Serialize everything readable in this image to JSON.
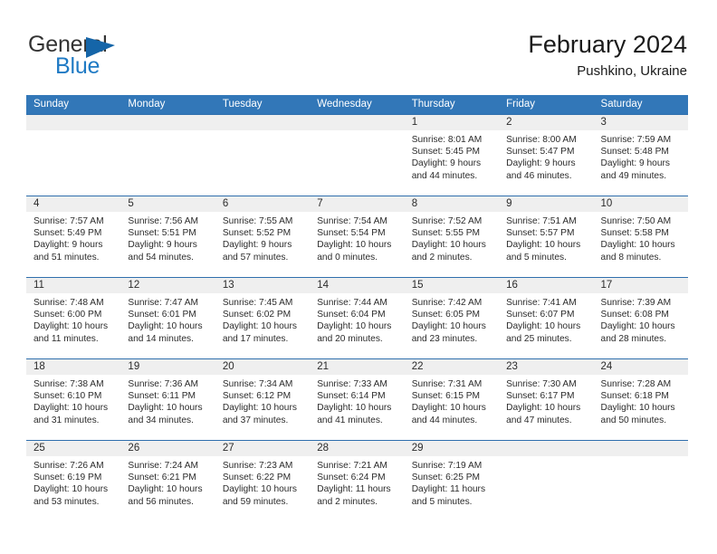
{
  "brand": {
    "name_top": "General",
    "name_bottom": "Blue",
    "triangle_color": "#1565a8",
    "blue_color": "#1f7ac4"
  },
  "header": {
    "title": "February 2024",
    "subtitle": "Pushkino, Ukraine"
  },
  "theme": {
    "header_blue": "#3277b8",
    "row_border_blue": "#2f6fad",
    "daynum_band": "#efefef",
    "text": "#2b2b2b"
  },
  "weekdays": [
    "Sunday",
    "Monday",
    "Tuesday",
    "Wednesday",
    "Thursday",
    "Friday",
    "Saturday"
  ],
  "weeks": [
    [
      {
        "day": "",
        "sunrise": "",
        "sunset": "",
        "daylight_1": "",
        "daylight_2": ""
      },
      {
        "day": "",
        "sunrise": "",
        "sunset": "",
        "daylight_1": "",
        "daylight_2": ""
      },
      {
        "day": "",
        "sunrise": "",
        "sunset": "",
        "daylight_1": "",
        "daylight_2": ""
      },
      {
        "day": "",
        "sunrise": "",
        "sunset": "",
        "daylight_1": "",
        "daylight_2": ""
      },
      {
        "day": "1",
        "sunrise": "Sunrise: 8:01 AM",
        "sunset": "Sunset: 5:45 PM",
        "daylight_1": "Daylight: 9 hours",
        "daylight_2": "and 44 minutes."
      },
      {
        "day": "2",
        "sunrise": "Sunrise: 8:00 AM",
        "sunset": "Sunset: 5:47 PM",
        "daylight_1": "Daylight: 9 hours",
        "daylight_2": "and 46 minutes."
      },
      {
        "day": "3",
        "sunrise": "Sunrise: 7:59 AM",
        "sunset": "Sunset: 5:48 PM",
        "daylight_1": "Daylight: 9 hours",
        "daylight_2": "and 49 minutes."
      }
    ],
    [
      {
        "day": "4",
        "sunrise": "Sunrise: 7:57 AM",
        "sunset": "Sunset: 5:49 PM",
        "daylight_1": "Daylight: 9 hours",
        "daylight_2": "and 51 minutes."
      },
      {
        "day": "5",
        "sunrise": "Sunrise: 7:56 AM",
        "sunset": "Sunset: 5:51 PM",
        "daylight_1": "Daylight: 9 hours",
        "daylight_2": "and 54 minutes."
      },
      {
        "day": "6",
        "sunrise": "Sunrise: 7:55 AM",
        "sunset": "Sunset: 5:52 PM",
        "daylight_1": "Daylight: 9 hours",
        "daylight_2": "and 57 minutes."
      },
      {
        "day": "7",
        "sunrise": "Sunrise: 7:54 AM",
        "sunset": "Sunset: 5:54 PM",
        "daylight_1": "Daylight: 10 hours",
        "daylight_2": "and 0 minutes."
      },
      {
        "day": "8",
        "sunrise": "Sunrise: 7:52 AM",
        "sunset": "Sunset: 5:55 PM",
        "daylight_1": "Daylight: 10 hours",
        "daylight_2": "and 2 minutes."
      },
      {
        "day": "9",
        "sunrise": "Sunrise: 7:51 AM",
        "sunset": "Sunset: 5:57 PM",
        "daylight_1": "Daylight: 10 hours",
        "daylight_2": "and 5 minutes."
      },
      {
        "day": "10",
        "sunrise": "Sunrise: 7:50 AM",
        "sunset": "Sunset: 5:58 PM",
        "daylight_1": "Daylight: 10 hours",
        "daylight_2": "and 8 minutes."
      }
    ],
    [
      {
        "day": "11",
        "sunrise": "Sunrise: 7:48 AM",
        "sunset": "Sunset: 6:00 PM",
        "daylight_1": "Daylight: 10 hours",
        "daylight_2": "and 11 minutes."
      },
      {
        "day": "12",
        "sunrise": "Sunrise: 7:47 AM",
        "sunset": "Sunset: 6:01 PM",
        "daylight_1": "Daylight: 10 hours",
        "daylight_2": "and 14 minutes."
      },
      {
        "day": "13",
        "sunrise": "Sunrise: 7:45 AM",
        "sunset": "Sunset: 6:02 PM",
        "daylight_1": "Daylight: 10 hours",
        "daylight_2": "and 17 minutes."
      },
      {
        "day": "14",
        "sunrise": "Sunrise: 7:44 AM",
        "sunset": "Sunset: 6:04 PM",
        "daylight_1": "Daylight: 10 hours",
        "daylight_2": "and 20 minutes."
      },
      {
        "day": "15",
        "sunrise": "Sunrise: 7:42 AM",
        "sunset": "Sunset: 6:05 PM",
        "daylight_1": "Daylight: 10 hours",
        "daylight_2": "and 23 minutes."
      },
      {
        "day": "16",
        "sunrise": "Sunrise: 7:41 AM",
        "sunset": "Sunset: 6:07 PM",
        "daylight_1": "Daylight: 10 hours",
        "daylight_2": "and 25 minutes."
      },
      {
        "day": "17",
        "sunrise": "Sunrise: 7:39 AM",
        "sunset": "Sunset: 6:08 PM",
        "daylight_1": "Daylight: 10 hours",
        "daylight_2": "and 28 minutes."
      }
    ],
    [
      {
        "day": "18",
        "sunrise": "Sunrise: 7:38 AM",
        "sunset": "Sunset: 6:10 PM",
        "daylight_1": "Daylight: 10 hours",
        "daylight_2": "and 31 minutes."
      },
      {
        "day": "19",
        "sunrise": "Sunrise: 7:36 AM",
        "sunset": "Sunset: 6:11 PM",
        "daylight_1": "Daylight: 10 hours",
        "daylight_2": "and 34 minutes."
      },
      {
        "day": "20",
        "sunrise": "Sunrise: 7:34 AM",
        "sunset": "Sunset: 6:12 PM",
        "daylight_1": "Daylight: 10 hours",
        "daylight_2": "and 37 minutes."
      },
      {
        "day": "21",
        "sunrise": "Sunrise: 7:33 AM",
        "sunset": "Sunset: 6:14 PM",
        "daylight_1": "Daylight: 10 hours",
        "daylight_2": "and 41 minutes."
      },
      {
        "day": "22",
        "sunrise": "Sunrise: 7:31 AM",
        "sunset": "Sunset: 6:15 PM",
        "daylight_1": "Daylight: 10 hours",
        "daylight_2": "and 44 minutes."
      },
      {
        "day": "23",
        "sunrise": "Sunrise: 7:30 AM",
        "sunset": "Sunset: 6:17 PM",
        "daylight_1": "Daylight: 10 hours",
        "daylight_2": "and 47 minutes."
      },
      {
        "day": "24",
        "sunrise": "Sunrise: 7:28 AM",
        "sunset": "Sunset: 6:18 PM",
        "daylight_1": "Daylight: 10 hours",
        "daylight_2": "and 50 minutes."
      }
    ],
    [
      {
        "day": "25",
        "sunrise": "Sunrise: 7:26 AM",
        "sunset": "Sunset: 6:19 PM",
        "daylight_1": "Daylight: 10 hours",
        "daylight_2": "and 53 minutes."
      },
      {
        "day": "26",
        "sunrise": "Sunrise: 7:24 AM",
        "sunset": "Sunset: 6:21 PM",
        "daylight_1": "Daylight: 10 hours",
        "daylight_2": "and 56 minutes."
      },
      {
        "day": "27",
        "sunrise": "Sunrise: 7:23 AM",
        "sunset": "Sunset: 6:22 PM",
        "daylight_1": "Daylight: 10 hours",
        "daylight_2": "and 59 minutes."
      },
      {
        "day": "28",
        "sunrise": "Sunrise: 7:21 AM",
        "sunset": "Sunset: 6:24 PM",
        "daylight_1": "Daylight: 11 hours",
        "daylight_2": "and 2 minutes."
      },
      {
        "day": "29",
        "sunrise": "Sunrise: 7:19 AM",
        "sunset": "Sunset: 6:25 PM",
        "daylight_1": "Daylight: 11 hours",
        "daylight_2": "and 5 minutes."
      },
      {
        "day": "",
        "sunrise": "",
        "sunset": "",
        "daylight_1": "",
        "daylight_2": ""
      },
      {
        "day": "",
        "sunrise": "",
        "sunset": "",
        "daylight_1": "",
        "daylight_2": ""
      }
    ]
  ]
}
